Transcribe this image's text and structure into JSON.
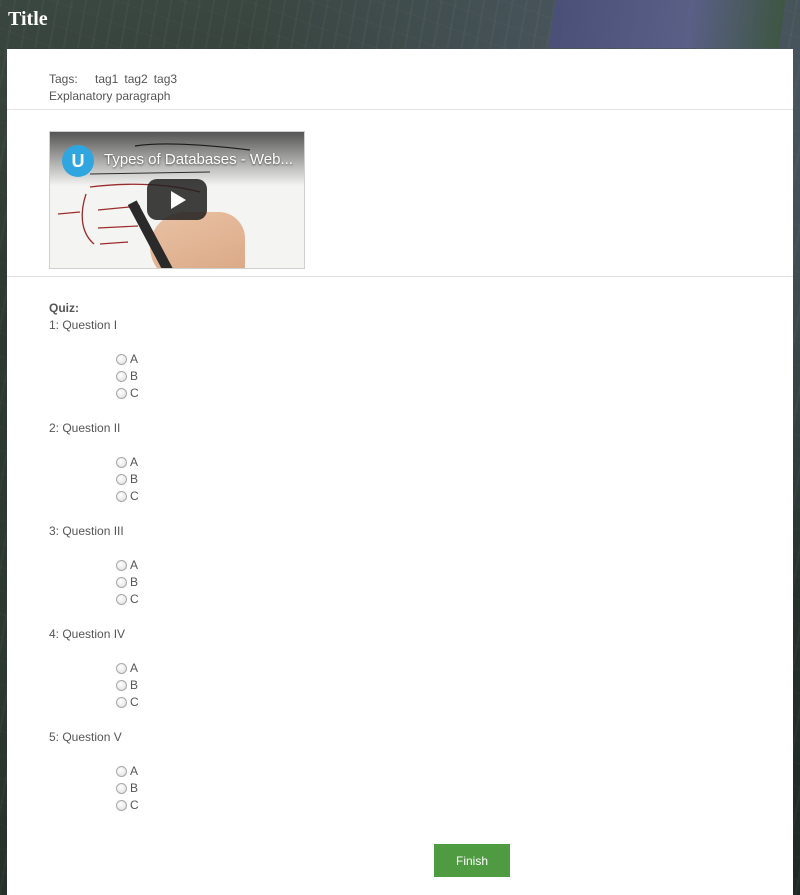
{
  "app": {
    "title": "Title"
  },
  "meta": {
    "tags_label": "Tags:",
    "tags": [
      "tag1",
      "tag2",
      "tag3"
    ],
    "paragraph": "Explanatory paragraph"
  },
  "video": {
    "title": "Types of Databases - Web...",
    "logo_letter": "U",
    "logo_color": "#2fa6df"
  },
  "quiz": {
    "heading": "Quiz:",
    "questions": [
      {
        "label": "1: Question I",
        "options": [
          "A",
          "B",
          "C"
        ]
      },
      {
        "label": "2: Question II",
        "options": [
          "A",
          "B",
          "C"
        ]
      },
      {
        "label": "3: Question III",
        "options": [
          "A",
          "B",
          "C"
        ]
      },
      {
        "label": "4: Question IV",
        "options": [
          "A",
          "B",
          "C"
        ]
      },
      {
        "label": "5: Question V",
        "options": [
          "A",
          "B",
          "C"
        ]
      }
    ],
    "finish_label": "Finish",
    "finish_color": "#4f9b41"
  }
}
